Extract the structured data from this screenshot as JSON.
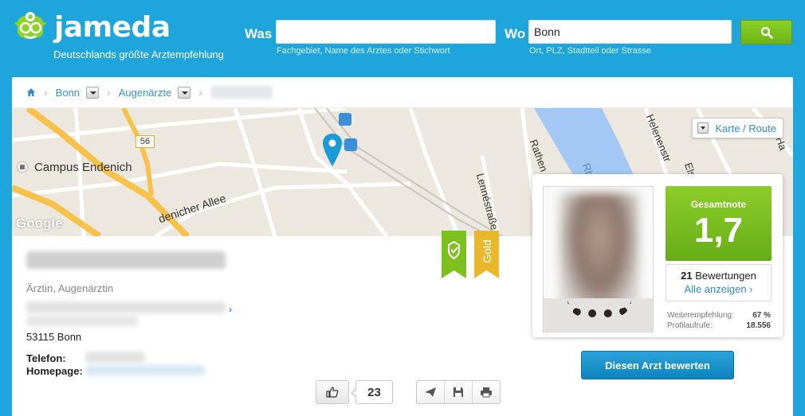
{
  "header": {
    "brand": "jameda",
    "tagline": "Deutschlands größte Arztempfehlung",
    "was": {
      "label": "Was",
      "value": "",
      "hint": "Fachgebiet, Name des Arztes oder Stichwort"
    },
    "wo": {
      "label": "Wo",
      "value": "Bonn",
      "hint": "Ort, PLZ, Stadtteil oder Strasse"
    },
    "search_icon": "search-icon"
  },
  "breadcrumb": {
    "home_icon": "home-icon",
    "items": [
      "Bonn",
      "Augenärzte"
    ]
  },
  "map": {
    "labels": {
      "campus": "Campus Endenich",
      "road_number": "56",
      "allee": "denicher Allee",
      "lenne": "Lennéstraße",
      "rathen": "Rathen",
      "helenen": "Helenenstr",
      "adolf": "dolf-Ha",
      "els": "Els",
      "rh": "Rh",
      "google": "Google"
    },
    "karte_button": "Karte / Route"
  },
  "profile": {
    "specialty": "Ärztin, Augenärztin",
    "city": "53115 Bonn",
    "telefon_label": "Telefon:",
    "homepage_label": "Homepage:",
    "ribbon_gold": "Gold",
    "likes": "23"
  },
  "rating": {
    "title": "Gesamtnote",
    "grade": "1,7",
    "reviews_count": "21",
    "reviews_label": "Bewertungen",
    "show_all": "Alle anzeigen ›",
    "weiterempfehlung_label": "Weiterempfehlung:",
    "weiterempfehlung_value": "67 %",
    "profilaufrufe_label": "Profilaufrufe:",
    "profilaufrufe_value": "18.556"
  },
  "rate_button": "Diesen Arzt bewerten",
  "colors": {
    "brand_blue": "#1ea5dc",
    "grade_green": "#7cc11f",
    "ribbon_gold": "#e8b82a",
    "link_blue": "#2f8fc6"
  }
}
